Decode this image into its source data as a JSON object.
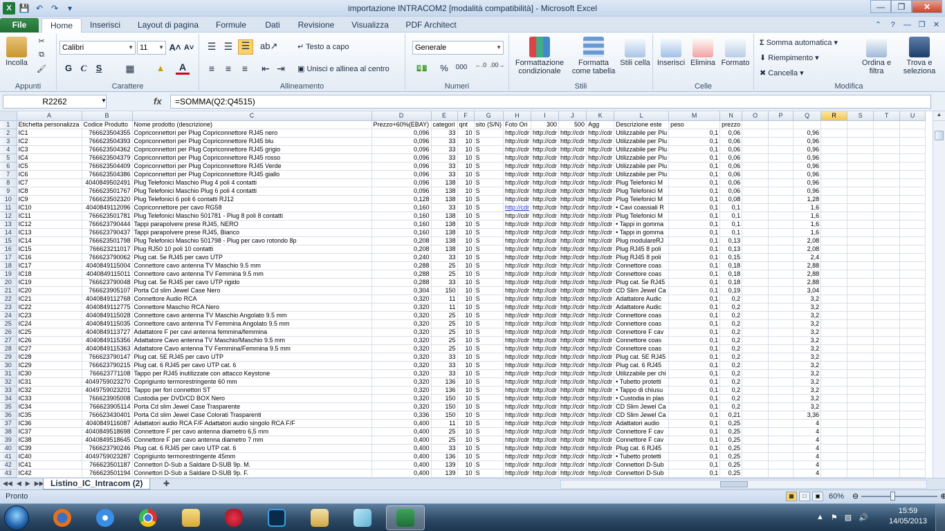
{
  "window": {
    "title": "importazione INTRACOM2  [modalità compatibilità] - Microsoft Excel"
  },
  "tabs": [
    "File",
    "Home",
    "Inserisci",
    "Layout di pagina",
    "Formule",
    "Dati",
    "Revisione",
    "Visualizza",
    "PDF Architect"
  ],
  "ribbon": {
    "clipboard": {
      "paste": "Incolla",
      "label": "Appunti"
    },
    "font": {
      "name": "Calibri",
      "size": "11",
      "bold": "G",
      "italic": "C",
      "underline": "S",
      "label": "Carattere"
    },
    "alignment": {
      "wrap": "Testo a capo",
      "merge": "Unisci e allinea al centro",
      "label": "Allineamento"
    },
    "number": {
      "format": "Generale",
      "percent": "%",
      "thousands": "000",
      "label": "Numeri"
    },
    "styles": {
      "conditional": "Formattazione condizionale",
      "table": "Formatta come tabella",
      "cell": "Stili cella",
      "label": "Stili"
    },
    "cells": {
      "insert": "Inserisci",
      "delete": "Elimina",
      "format": "Formato",
      "label": "Celle"
    },
    "editing": {
      "autosum": "Somma automatica",
      "fill": "Riempimento",
      "clear": "Cancella",
      "sort": "Ordina e filtra",
      "find": "Trova e seleziona",
      "label": "Modifica"
    }
  },
  "formula_bar": {
    "name_box": "R2262",
    "fx": "fx",
    "formula": "=SOMMA(Q2:Q4515)"
  },
  "columns": [
    "A",
    "B",
    "C",
    "D",
    "E",
    "F",
    "G",
    "H",
    "I",
    "J",
    "K",
    "L",
    "M",
    "N",
    "O",
    "P",
    "Q",
    "R",
    "S",
    "T",
    "U"
  ],
  "header_row": [
    "Etichetta personalizza",
    "Codice Produtto",
    "Nome prodotto (descrizione)",
    "Prezzo+60%(EBAY)",
    "categori",
    "qnt",
    "sito (S/N)",
    "Foto Ori",
    "300",
    "500",
    "Agg",
    "Descrizione este",
    "peso",
    "prezzo",
    "",
    "",
    "",
    "",
    "",
    "",
    ""
  ],
  "rows": [
    [
      "IC1",
      "766623504355",
      "Copriconnettori per Plug Copriconnettore RJ45 nero",
      "0,096",
      "33",
      "10",
      "S",
      "http://cdr",
      "http://cdr",
      "http://cdr",
      "http://cdr",
      "Utilizzabile per Plu",
      "0,1",
      "0,06",
      "",
      "",
      "0,96"
    ],
    [
      "IC2",
      "766623504393",
      "Copriconnettori per Plug Copriconnettore RJ45 blu",
      "0,096",
      "33",
      "10",
      "S",
      "http://cdr",
      "http://cdr",
      "http://cdr",
      "http://cdr",
      "Utilizzabile per Plu",
      "0,1",
      "0,06",
      "",
      "",
      "0,96"
    ],
    [
      "IC3",
      "766623504362",
      "Copriconnettori per Plug Copriconnettore RJ45 grigio",
      "0,096",
      "33",
      "10",
      "S",
      "http://cdr",
      "http://cdr",
      "http://cdr",
      "http://cdr",
      "Utilizzabile per Plu",
      "0,1",
      "0,06",
      "",
      "",
      "0,96"
    ],
    [
      "IC4",
      "766623504379",
      "Copriconnettori per Plug Copriconnettore RJ45 rosso",
      "0,096",
      "33",
      "10",
      "S",
      "http://cdr",
      "http://cdr",
      "http://cdr",
      "http://cdr",
      "Utilizzabile per Plu",
      "0,1",
      "0,06",
      "",
      "",
      "0,96"
    ],
    [
      "IC5",
      "766623504409",
      "Copriconnettori per Plug Copriconnettore RJ45 Verde",
      "0,096",
      "33",
      "10",
      "S",
      "http://cdr",
      "http://cdr",
      "http://cdr",
      "http://cdr",
      "Utilizzabile per Plu",
      "0,1",
      "0,06",
      "",
      "",
      "0,96"
    ],
    [
      "IC6",
      "766623504386",
      "Copriconnettori per Plug Copriconnettore RJ45 giallo",
      "0,096",
      "33",
      "10",
      "S",
      "http://cdr",
      "http://cdr",
      "http://cdr",
      "http://cdr",
      "Utilizzabile per Plu",
      "0,1",
      "0,06",
      "",
      "",
      "0,96"
    ],
    [
      "IC7",
      "4040849502491",
      "Plug Telefonici Maschio Plug 4 poli 4 contatti",
      "0,096",
      "138",
      "10",
      "S",
      "http://cdr",
      "http://cdr",
      "http://cdr",
      "http://cdr",
      "Plug Telefonici M",
      "0,1",
      "0,06",
      "",
      "",
      "0,96"
    ],
    [
      "IC8",
      "766623501767",
      "Plug Telefonici Maschio Plug 6 poli 4 contatti",
      "0,096",
      "138",
      "10",
      "S",
      "http://cdr",
      "http://cdr",
      "http://cdr",
      "http://cdr",
      "Plug Telefonici M",
      "0,1",
      "0,06",
      "",
      "",
      "0,96"
    ],
    [
      "IC9",
      "766623502320",
      "Plug Telefonici 6 poli 6 contatti RJ12",
      "0,128",
      "138",
      "10",
      "S",
      "http://cdr",
      "http://cdr",
      "http://cdr",
      "http://cdr",
      "Plug Telefonici M",
      "0,1",
      "0,08",
      "",
      "",
      "1,28"
    ],
    [
      "IC10",
      "4040849112096",
      "Copriconnettore per cavo RG58",
      "0,160",
      "33",
      "10",
      "S",
      "http://cdr",
      "http://cdr",
      "http://cdr",
      "http://cdr",
      "• Cavi coassiali R",
      "0,1",
      "0,1",
      "",
      "",
      "1,6"
    ],
    [
      "IC11",
      "766623501781",
      "Plug Telefonici Maschio 501781 - Plug 8 poli 8 contatti",
      "0,160",
      "138",
      "10",
      "S",
      "http://cdr",
      "http://cdr",
      "http://cdr",
      "http://cdr",
      "Plug Telefonici M",
      "0,1",
      "0,1",
      "",
      "",
      "1,6"
    ],
    [
      "IC12",
      "766623790444",
      "Tappi parapolvere prese RJ45, NERO",
      "0,160",
      "138",
      "10",
      "S",
      "http://cdr",
      "http://cdr",
      "http://cdr",
      "http://cdr",
      "• Tappi in gomma",
      "0,1",
      "0,1",
      "",
      "",
      "1,6"
    ],
    [
      "IC13",
      "766623790437",
      "Tappi parapolvere prese RJ45, Bianco",
      "0,160",
      "138",
      "10",
      "S",
      "http://cdr",
      "http://cdr",
      "http://cdr",
      "http://cdr",
      "• Tappi in gomma",
      "0,1",
      "0,1",
      "",
      "",
      "1,6"
    ],
    [
      "IC14",
      "766623501798",
      "Plug Telefonici Maschio 501798 - Plug per cavo rotondo 8p",
      "0,208",
      "138",
      "10",
      "S",
      "http://cdr",
      "http://cdr",
      "http://cdr",
      "http://cdr",
      "Plug modulareRJ",
      "0,1",
      "0,13",
      "",
      "",
      "2,08"
    ],
    [
      "IC15",
      "766623211017",
      "Plug RJ50 10 poli 10 contatti",
      "0,208",
      "138",
      "10",
      "S",
      "http://cdr",
      "http://cdr",
      "http://cdr",
      "http://cdr",
      "Plug RJ45 8 poli",
      "0,1",
      "0,13",
      "",
      "",
      "2,08"
    ],
    [
      "IC16",
      "766623790062",
      "Plug cat. 5e RJ45 per cavo UTP",
      "0,240",
      "33",
      "10",
      "S",
      "http://cdr",
      "http://cdr",
      "http://cdr",
      "http://cdr",
      "Plug RJ45 8 poli",
      "0,1",
      "0,15",
      "",
      "",
      "2,4"
    ],
    [
      "IC17",
      "4040849115004",
      "Connettore cavo antenna TV  Maschio 9.5 mm",
      "0,288",
      "25",
      "10",
      "S",
      "http://cdr",
      "http://cdr",
      "http://cdr",
      "http://cdr",
      "Connettore coas",
      "0,1",
      "0,18",
      "",
      "",
      "2,88"
    ],
    [
      "IC18",
      "4040849115011",
      "Connettore cavo antenna TV  Femmina 9.5 mm",
      "0,288",
      "25",
      "10",
      "S",
      "http://cdr",
      "http://cdr",
      "http://cdr",
      "http://cdr",
      "Connettore coas",
      "0,1",
      "0,18",
      "",
      "",
      "2,88"
    ],
    [
      "IC19",
      "766623790048",
      "Plug cat. 5e RJ45 per cavo UTP rigido",
      "0,288",
      "33",
      "10",
      "S",
      "http://cdr",
      "http://cdr",
      "http://cdr",
      "http://cdr",
      "Plug cat. 5e RJ45",
      "0,1",
      "0,18",
      "",
      "",
      "2,88"
    ],
    [
      "IC20",
      "766623905107",
      "Porta Cd slim Jewel Case Nero",
      "0,304",
      "150",
      "10",
      "S",
      "http://cdr",
      "http://cdr",
      "http://cdr",
      "http://cdr",
      "CD Slim Jewel Ca",
      "0,1",
      "0,19",
      "",
      "",
      "3,04"
    ],
    [
      "IC21",
      "4040849112768",
      "Connettore Audio RCA",
      "0,320",
      "11",
      "10",
      "S",
      "http://cdr",
      "http://cdr",
      "http://cdr",
      "http://cdr",
      "Adattatore Audic",
      "0,1",
      "0,2",
      "",
      "",
      "3,2"
    ],
    [
      "IC22",
      "4040849112775",
      "Connettore Maschio RCA Nero",
      "0,320",
      "11",
      "10",
      "S",
      "http://cdr",
      "http://cdr",
      "http://cdr",
      "http://cdr",
      "Adattatore Audic",
      "0,1",
      "0,2",
      "",
      "",
      "3,2"
    ],
    [
      "IC23",
      "4040849115028",
      "Connettore cavo antenna TV  Maschio Angolato 9.5 mm",
      "0,320",
      "25",
      "10",
      "S",
      "http://cdr",
      "http://cdr",
      "http://cdr",
      "http://cdr",
      "Connettore coas",
      "0,1",
      "0,2",
      "",
      "",
      "3,2"
    ],
    [
      "IC24",
      "4040849115035",
      "Connettore cavo antenna TV  Femmina Angolato 9.5 mm",
      "0,320",
      "25",
      "10",
      "S",
      "http://cdr",
      "http://cdr",
      "http://cdr",
      "http://cdr",
      "Connettore coas",
      "0,1",
      "0,2",
      "",
      "",
      "3,2"
    ],
    [
      "IC25",
      "4040849113727",
      "Adattatore F per cavi antenna femmina/femmina",
      "0,320",
      "25",
      "10",
      "S",
      "http://cdr",
      "http://cdr",
      "http://cdr",
      "http://cdr",
      "Connettore F cav",
      "0,1",
      "0,2",
      "",
      "",
      "3,2"
    ],
    [
      "IC26",
      "4040849115356",
      "Adattatore Cavo antenna TV Maschio/Maschio  9.5 mm",
      "0,320",
      "25",
      "10",
      "S",
      "http://cdr",
      "http://cdr",
      "http://cdr",
      "http://cdr",
      "Connettore coas",
      "0,1",
      "0,2",
      "",
      "",
      "3,2"
    ],
    [
      "IC27",
      "4040849115363",
      "Adattatore Cavo antenna TV Femmina/Femmina  9.5 mm",
      "0,320",
      "25",
      "10",
      "S",
      "http://cdr",
      "http://cdr",
      "http://cdr",
      "http://cdr",
      "Connettore coas",
      "0,1",
      "0,2",
      "",
      "",
      "3,2"
    ],
    [
      "IC28",
      "766623790147",
      "Plug cat. 5E RJ45 per cavo UTP",
      "0,320",
      "33",
      "10",
      "S",
      "http://cdr",
      "http://cdr",
      "http://cdr",
      "http://cdr",
      "Plug cat. 5E RJ45",
      "0,1",
      "0,2",
      "",
      "",
      "3,2"
    ],
    [
      "IC29",
      "766623790215",
      "Plug cat. 6 RJ45 per cavo UTP cat. 6",
      "0,320",
      "33",
      "10",
      "S",
      "http://cdr",
      "http://cdr",
      "http://cdr",
      "http://cdr",
      "Plug cat. 6 RJ45",
      "0,1",
      "0,2",
      "",
      "",
      "3,2"
    ],
    [
      "IC30",
      "766623771108",
      "Tappo per RJ45 inutilizzate con attacco Keystone",
      "0,320",
      "33",
      "10",
      "S",
      "http://cdr",
      "http://cdr",
      "http://cdr",
      "http://cdr",
      "Utilizzabile per chi",
      "0,1",
      "0,2",
      "",
      "",
      "3,2"
    ],
    [
      "IC31",
      "4049759023270",
      "Coprigiunto termorestringente 60 mm",
      "0,320",
      "136",
      "10",
      "S",
      "http://cdr",
      "http://cdr",
      "http://cdr",
      "http://cdr",
      "• Tubetto protetti",
      "0,1",
      "0,2",
      "",
      "",
      "3,2"
    ],
    [
      "IC32",
      "4049759023201",
      "Tappo per fori connettori ST",
      "0,320",
      "136",
      "10",
      "S",
      "http://cdr",
      "http://cdr",
      "http://cdr",
      "http://cdr",
      "• Tappo di chiusu",
      "0,1",
      "0,2",
      "",
      "",
      "3,2"
    ],
    [
      "IC33",
      "766623905008",
      "Custodia per DVD/CD BOX  Nero",
      "0,320",
      "150",
      "10",
      "S",
      "http://cdr",
      "http://cdr",
      "http://cdr",
      "http://cdr",
      "• Custodia in plas",
      "0,1",
      "0,2",
      "",
      "",
      "3,2"
    ],
    [
      "IC34",
      "766623905114",
      "Porta Cd slim Jewel Case Trasparente",
      "0,320",
      "150",
      "10",
      "S",
      "http://cdr",
      "http://cdr",
      "http://cdr",
      "http://cdr",
      "CD Slim Jewel Ca",
      "0,1",
      "0,2",
      "",
      "",
      "3,2"
    ],
    [
      "IC35",
      "766623430401",
      "Porta Cd slim Jewel Case Colorati Trasparenti",
      "0,336",
      "150",
      "10",
      "S",
      "http://cdr",
      "http://cdr",
      "http://cdr",
      "http://cdr",
      "CD Slim Jewel Ca",
      "0,1",
      "0,21",
      "",
      "",
      "3,36"
    ],
    [
      "IC36",
      "4040849116087",
      "Adattatori audio RCA F/F Adattatori audio singolo RCA F/F",
      "0,400",
      "11",
      "10",
      "S",
      "http://cdr",
      "http://cdr",
      "http://cdr",
      "http://cdr",
      "Adattatori audio",
      "0,1",
      "0,25",
      "",
      "",
      "4"
    ],
    [
      "IC37",
      "4040849518698",
      "Connettore F per cavo antenna diametro 6,5 mm",
      "0,400",
      "25",
      "10",
      "S",
      "http://cdr",
      "http://cdr",
      "http://cdr",
      "http://cdr",
      "Connettore F cav",
      "0,1",
      "0,25",
      "",
      "",
      "4"
    ],
    [
      "IC38",
      "4040849518645",
      "Connettore F per cavo antenna diametro 7 mm",
      "0,400",
      "25",
      "10",
      "S",
      "http://cdr",
      "http://cdr",
      "http://cdr",
      "http://cdr",
      "Connettore F cav",
      "0,1",
      "0,25",
      "",
      "",
      "4"
    ],
    [
      "IC39",
      "766623790246",
      "Plug cat. 6 RJ45 per cavo UTP cat. 6",
      "0,400",
      "33",
      "10",
      "S",
      "http://cdr",
      "http://cdr",
      "http://cdr",
      "http://cdr",
      "Plug cat. 6 RJ45",
      "0,1",
      "0,25",
      "",
      "",
      "4"
    ],
    [
      "IC40",
      "4049759023287",
      "Coprigiunto termorestringente 45mm",
      "0,400",
      "136",
      "10",
      "S",
      "http://cdr",
      "http://cdr",
      "http://cdr",
      "http://cdr",
      "• Tubetto protetti",
      "0,1",
      "0,25",
      "",
      "",
      "4"
    ],
    [
      "IC41",
      "766623501187",
      "Connettori D-Sub a Saldare D-SUB 9p. M.",
      "0,400",
      "139",
      "10",
      "S",
      "http://cdr",
      "http://cdr",
      "http://cdr",
      "http://cdr",
      "Connettori D-Sub",
      "0,1",
      "0,25",
      "",
      "",
      "4"
    ],
    [
      "IC42",
      "766623501194",
      "Connettori D-Sub a Saldare D-SUB 9p. F.",
      "0,400",
      "139",
      "10",
      "S",
      "http://cdr",
      "http://cdr",
      "http://cdr",
      "http://cdr",
      "Connettori D-Sub",
      "0,1",
      "0,25",
      "",
      "",
      "4"
    ]
  ],
  "sheet_tab": "Listino_IC_Intracom (2)",
  "status": {
    "text": "Pronto",
    "zoom": "60%"
  },
  "taskbar": {
    "time": "15:59",
    "date": "14/05/2013"
  }
}
